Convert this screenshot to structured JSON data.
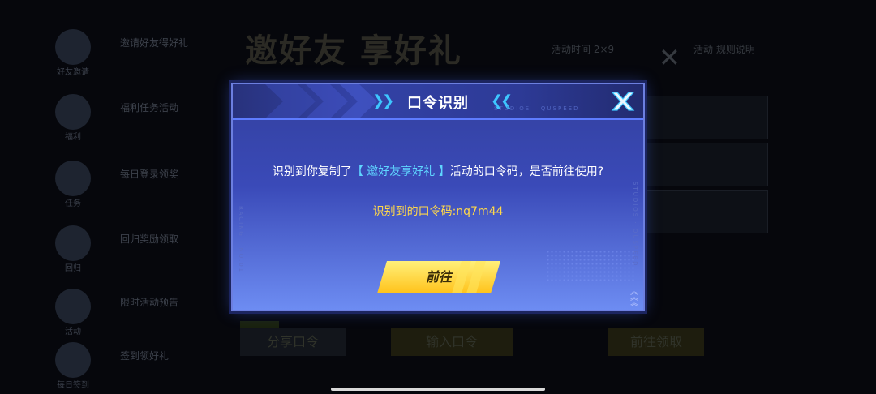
{
  "background": {
    "title": "邀好友 享好礼",
    "top_right_left": "活动时间 2×9",
    "top_right_right": "活动 规则说明",
    "buttons": [
      "分享口令",
      "输入口令",
      "前往领取"
    ],
    "sidebar_captions": [
      "好友邀请",
      "福利",
      "任务",
      "回归",
      "活动",
      "每日签到"
    ],
    "sidebar_texts": [
      "邀请好友得好礼",
      "福利任务活动",
      "每日登录领奖",
      "回归奖励领取",
      "限时活动预告",
      "签到领好礼"
    ]
  },
  "dialog": {
    "title": "口令识别",
    "header_small": "STUDIOS · QUSPEED",
    "side_left": "RACING · NO.01",
    "side_right": "STUDIOS · QUSPEED",
    "message_before": "识别到你复制了",
    "message_highlight": "【 邀好友享好礼 】",
    "message_after": "活动的口令码，是否前往使用?",
    "code_label": "识别到的口令码:",
    "code_value": "nq7m44",
    "go_button": "前往",
    "colors": {
      "accent_cyan": "#3ec6ff",
      "highlight_text": "#5fd6ff",
      "code_yellow": "#ffd84a",
      "button_yellow": "#ffd43a"
    }
  }
}
